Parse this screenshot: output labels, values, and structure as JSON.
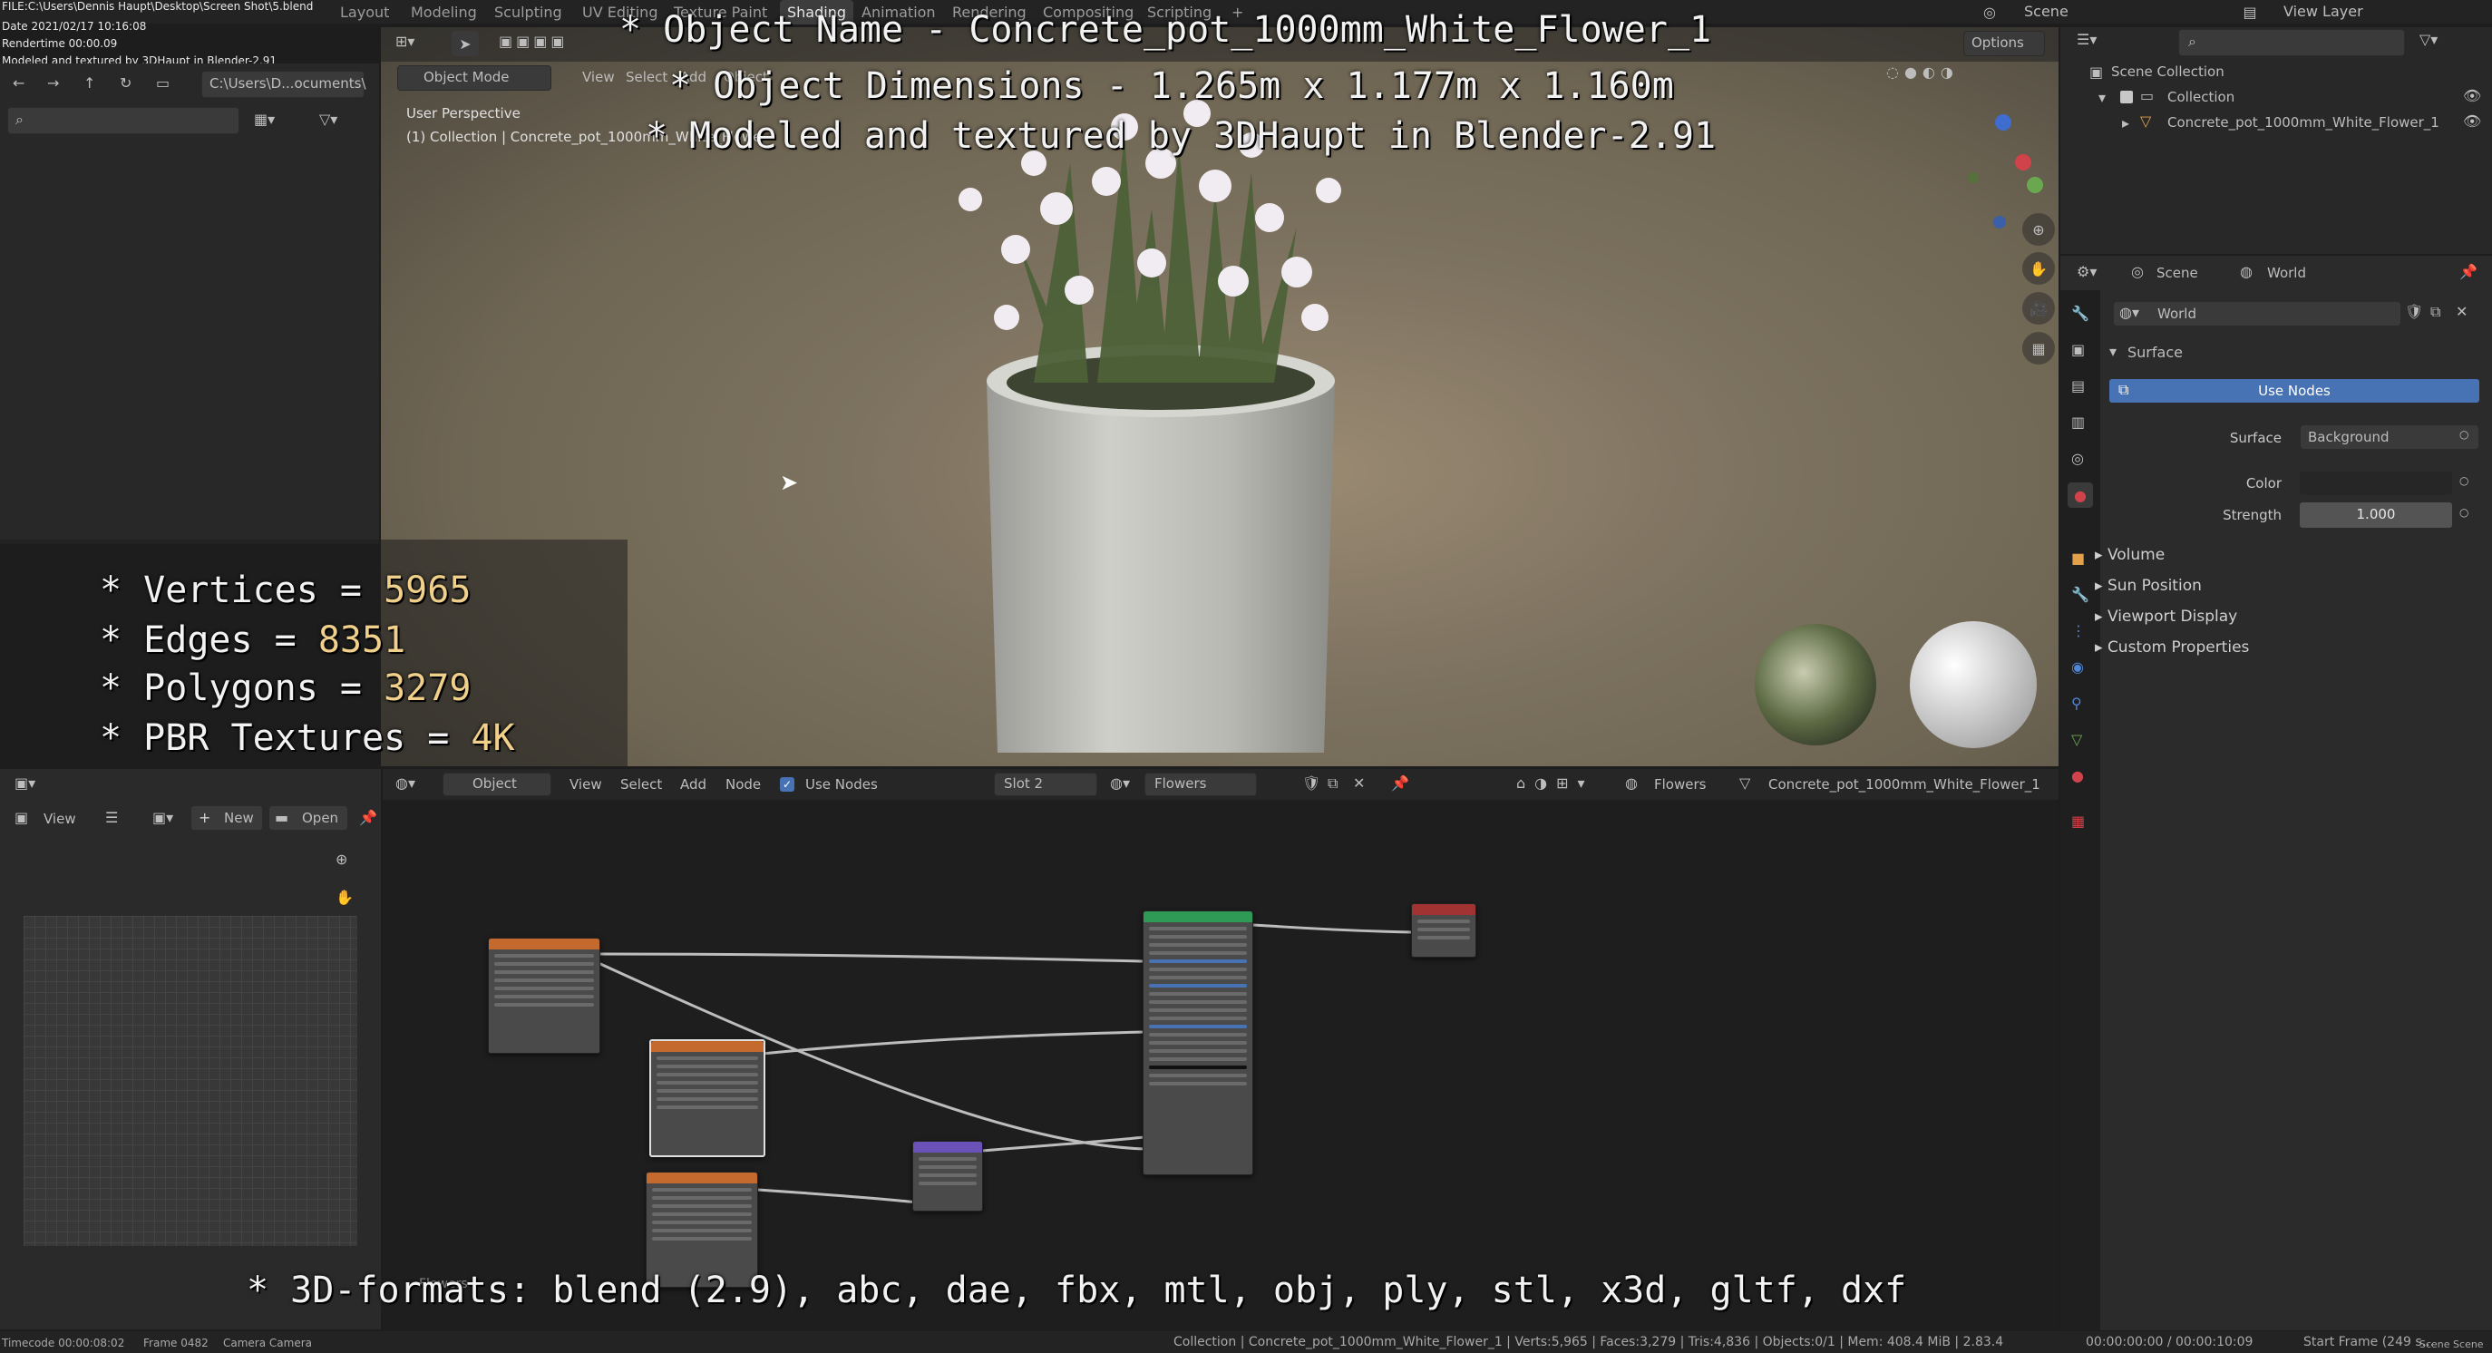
{
  "topbar": {
    "file_info": "FILE:C:\\Users\\Dennis Haupt\\Desktop\\Screen Shot\\5.blend",
    "date_info": "Date 2021/02/17 10:16:08",
    "render_time": "Rendertime 00:00.09",
    "modeled_note": "Modeled and textured by 3DHaupt in Blender-2.91",
    "workspaces": [
      "Layout",
      "Modeling",
      "Sculpting",
      "UV Editing",
      "Texture Paint",
      "Shading",
      "Animation",
      "Rendering",
      "Compositing",
      "Scripting",
      "+"
    ],
    "active_workspace": "Shading",
    "scene_label": "Scene",
    "view_layer_label": "View Layer"
  },
  "file_browser": {
    "path": "C:\\Users\\D...ocuments\\",
    "search_placeholder": ""
  },
  "viewport": {
    "mode": "Object Mode",
    "menus": [
      "View",
      "Select",
      "Add",
      "Object"
    ],
    "perspective": "User Perspective",
    "collection_path": "(1) Collection | Concrete_pot_1000mm_White_Flower_1",
    "options_label": "Options"
  },
  "overlay": {
    "object_name_line": "* Object Name - Concrete_pot_1000mm_White_Flower_1",
    "dimensions_line": "* Object Dimensions -  1.265m x 1.177m x 1.160m",
    "modeled_line": "* Modeled and textured by 3DHaupt in Blender-2.91",
    "stats": [
      {
        "label": "* Vertices = ",
        "value": "5965"
      },
      {
        "label": "* Edges = ",
        "value": "8351"
      },
      {
        "label": "* Polygons = ",
        "value": "3279"
      },
      {
        "label": "* PBR Textures = ",
        "value": "4K"
      }
    ],
    "formats_line": "* 3D-formats: blend (2.9), abc, dae, fbx, mtl, obj, ply, stl, x3d, gltf, dxf"
  },
  "outliner": {
    "scene_collection": "Scene Collection",
    "collection": "Collection",
    "object": "Concrete_pot_1000mm_White_Flower_1"
  },
  "properties": {
    "tab_scene": "Scene",
    "tab_world": "World",
    "world_name": "World",
    "surface_header": "Surface",
    "use_nodes_button": "Use Nodes",
    "surface_label": "Surface",
    "surface_value": "Background",
    "color_label": "Color",
    "strength_label": "Strength",
    "strength_value": "1.000",
    "collapsed_panels": [
      "Volume",
      "Sun Position",
      "Viewport Display",
      "Custom Properties"
    ]
  },
  "image_editor": {
    "view_label": "View",
    "new_label": "New",
    "open_label": "Open"
  },
  "node_editor": {
    "object_label": "Object",
    "menus": [
      "View",
      "Select",
      "Add",
      "Node"
    ],
    "use_nodes_label": "Use Nodes",
    "slot_label": "Slot 2",
    "material_name": "Flowers",
    "breadcrumb_material": "Flowers",
    "breadcrumb_object": "Concrete_pot_1000mm_White_Flower_1",
    "frame_label": "Flowers"
  },
  "statusbar": {
    "timecode": "Timecode 00:00:08:02",
    "frame": "Frame 0482",
    "camera": "Camera Camera",
    "stats": "Collection | Concrete_pot_1000mm_White_Flower_1 | Verts:5,965 | Faces:3,279 | Tris:4,836 | Objects:0/1 | Mem: 408.4 MiB | 2.83.4",
    "time": "00:00:00:00 / 00:00:10:09",
    "start_frame": "Start Frame (249 s...",
    "scene": "Scene Scene"
  },
  "colors": {
    "accent_blue": "#4772b3",
    "stat_value": "#f0d08a",
    "viewport_bg": "#7d7260",
    "node_orange": "#c46a2f",
    "node_green": "#2e9a55",
    "node_red": "#a23333",
    "node_purple": "#6a52b8"
  }
}
